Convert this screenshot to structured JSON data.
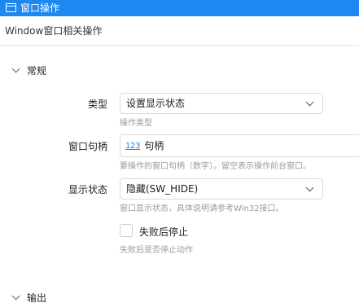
{
  "window": {
    "title": "窗口操作"
  },
  "subtitle": "Window窗口相关操作",
  "sections": {
    "general": {
      "label": "常规"
    },
    "output": {
      "label": "输出"
    }
  },
  "fields": {
    "type": {
      "label": "类型",
      "value": "设置显示状态",
      "hint": "操作类型"
    },
    "handle": {
      "label": "窗口句柄",
      "icon_text": "123",
      "value": "句柄",
      "hint": "要操作的窗口句柄（数字）。留空表示操作前台窗口。"
    },
    "show_state": {
      "label": "显示状态",
      "value": "隐藏(SW_HIDE)",
      "hint": "窗口显示状态，具体说明请参考Win32接口。"
    },
    "stop_on_fail": {
      "label": "失败后停止",
      "checked": false,
      "hint": "失败后是否停止动作"
    }
  },
  "colors": {
    "titlebar": "#1e88f0",
    "accent": "#1e7fd8",
    "hint": "#9a9a9a"
  }
}
